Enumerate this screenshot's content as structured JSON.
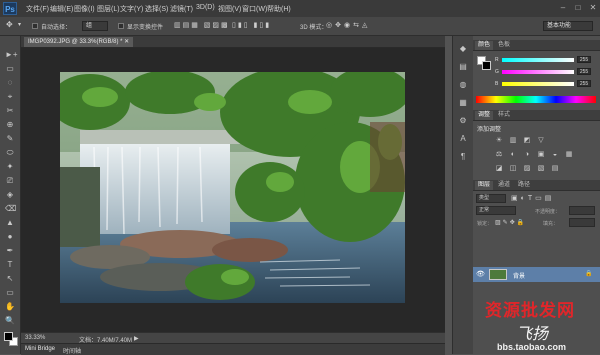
{
  "app": {
    "logo": "Ps",
    "menu": [
      "文件(F)",
      "编辑(E)",
      "图像(I)",
      "图层(L)",
      "文字(Y)",
      "选择(S)",
      "滤镜(T)",
      "3D(D)",
      "视图(V)",
      "窗口(W)",
      "帮助(H)"
    ],
    "window_controls": [
      "–",
      "□",
      "✕"
    ]
  },
  "options_bar": {
    "auto_select_label": "自动选择：",
    "auto_select_value": "组",
    "show_transform_label": "显示变换控件",
    "mode_3d_label": "3D 模式：",
    "workspace": "基本功能"
  },
  "document": {
    "tab_title": "IMGP0392.JPG @ 33.3%(RGB/8) *",
    "zoom": "33.33%",
    "doc_size": "文档：7.40M/7.40M",
    "mini_bridge_tabs": [
      "Mini Bridge",
      "时间轴"
    ]
  },
  "color_panel": {
    "tabs": [
      "颜色",
      "色板"
    ],
    "channels": [
      {
        "label": "R",
        "value": "255"
      },
      {
        "label": "G",
        "value": "255"
      },
      {
        "label": "B",
        "value": "255"
      }
    ]
  },
  "adjustments_panel": {
    "tabs": [
      "调整",
      "样式"
    ],
    "title": "添加调整",
    "row1": [
      "☀",
      "▥",
      "◩",
      "▽"
    ],
    "row2": [
      "⚖",
      "◐",
      "◑",
      "▣",
      "◒",
      "▦"
    ],
    "row3": [
      "◪",
      "◫",
      "▨",
      "▧",
      "▤"
    ]
  },
  "layers_panel": {
    "tabs": [
      "图层",
      "通道",
      "路径"
    ],
    "filter_label": "类型",
    "blend_mode": "正常",
    "opacity_label": "不透明度：",
    "lock_label": "锁定：",
    "fill_label": "填充：",
    "layer_name": "背景",
    "bottom_icons": [
      "⊘",
      "fx",
      "◙",
      "◉",
      "▭",
      "▤",
      "🗑"
    ]
  },
  "tools": [
    "►+",
    "▭",
    "◌",
    "⌖",
    "✂",
    "⊕",
    "✎",
    "⬭",
    "✦",
    "⎚",
    "◈",
    "⌫",
    "▲",
    "●",
    "✒",
    "T",
    "↖",
    "▭",
    "✋",
    "🔍"
  ],
  "right_strip_icons": [
    "◆",
    "▤",
    "◍",
    "▦",
    "⚙",
    "A",
    "¶"
  ],
  "watermark": {
    "line1": "资源批发网",
    "line2": "飞扬",
    "url": "bbs.taobao.com"
  }
}
